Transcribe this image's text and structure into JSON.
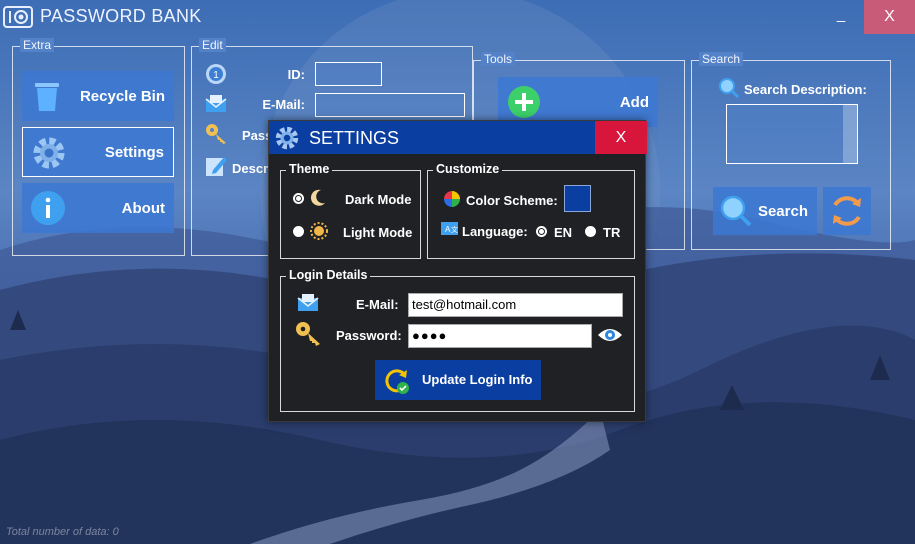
{
  "window": {
    "title": "PASSWORD BANK",
    "minimize_label": "_",
    "close_label": "X"
  },
  "extra": {
    "title": "Extra",
    "buttons": [
      {
        "label": "Recycle Bin",
        "icon": "trash-icon"
      },
      {
        "label": "Settings",
        "icon": "gear-icon"
      },
      {
        "label": "About",
        "icon": "info-icon"
      }
    ]
  },
  "edit": {
    "title": "Edit",
    "id_label": "ID:",
    "email_label": "E-Mail:",
    "password_label": "Pass",
    "description_label": "Descri"
  },
  "tools": {
    "title": "Tools",
    "add_label": "Add"
  },
  "search": {
    "title": "Search",
    "description_label": "Search Description:",
    "search_button": "Search"
  },
  "status": {
    "total_text": "Total number of data: 0"
  },
  "settings": {
    "title": "SETTINGS",
    "close_label": "X",
    "theme": {
      "title": "Theme",
      "dark_label": "Dark Mode",
      "light_label": "Light Mode",
      "selected": "dark"
    },
    "customize": {
      "title": "Customize",
      "color_scheme_label": "Color Scheme:",
      "color_scheme_value": "#0a3ea0",
      "language_label": "Language:",
      "lang_en": "EN",
      "lang_tr": "TR",
      "selected_language": "EN"
    },
    "login": {
      "title": "Login Details",
      "email_label": "E-Mail:",
      "email_value": "test@hotmail.com",
      "password_label": "Password:",
      "password_value": "●●●●",
      "update_button": "Update Login Info"
    }
  },
  "colors": {
    "accent": "#0a3ea0",
    "close_red": "#d8163c",
    "dialog_bg": "#1f2124"
  }
}
